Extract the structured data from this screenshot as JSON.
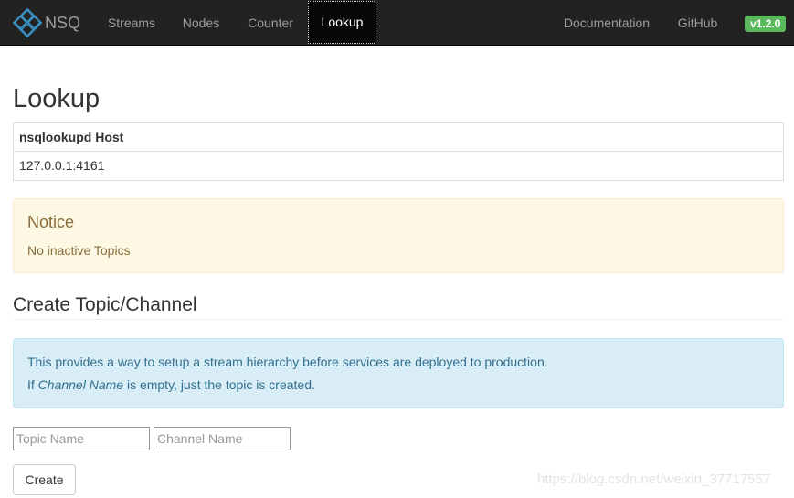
{
  "navbar": {
    "brand": "NSQ",
    "items": [
      {
        "label": "Streams"
      },
      {
        "label": "Nodes"
      },
      {
        "label": "Counter"
      },
      {
        "label": "Lookup",
        "active": true
      }
    ],
    "right_items": [
      {
        "label": "Documentation"
      },
      {
        "label": "GitHub"
      }
    ],
    "version": "v1.2.0",
    "icon": "nsq-logo-icon"
  },
  "main": {
    "title": "Lookup",
    "host_table": {
      "header": "nsqlookupd Host",
      "rows": [
        "127.0.0.1:4161"
      ]
    },
    "notice": {
      "title": "Notice",
      "text": "No inactive Topics"
    },
    "create_section": {
      "title": "Create Topic/Channel",
      "info_line1": "This provides a way to setup a stream hierarchy before services are deployed to production.",
      "info_line2_prefix": "If ",
      "info_line2_em": "Channel Name",
      "info_line2_suffix": " is empty, just the topic is created.",
      "topic_placeholder": "Topic Name",
      "topic_value": "",
      "channel_placeholder": "Channel Name",
      "channel_value": "",
      "create_label": "Create"
    }
  },
  "watermark": "https://blog.csdn.net/weixin_37717557",
  "colors": {
    "navbar_bg": "#222222",
    "badge": "#5cb85c",
    "logo": "#3a8fc2",
    "notice_bg": "#fcf8e3",
    "info_bg": "#d9edf7"
  }
}
